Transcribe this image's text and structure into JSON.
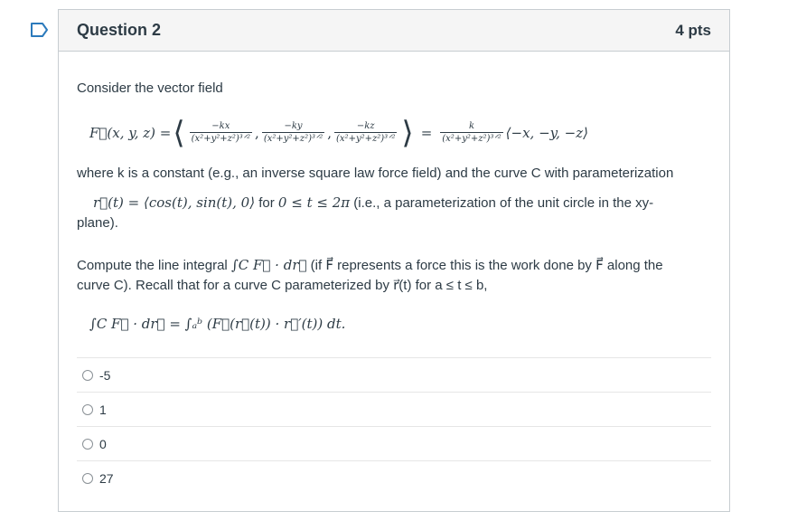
{
  "question": {
    "title": "Question 2",
    "points": "4 pts"
  },
  "body": {
    "intro": "Consider the vector field",
    "eq1_lhs": "F⃗(x, y, z) =",
    "eq1_num1": "−kx",
    "eq1_num2": "−ky",
    "eq1_num3": "−kz",
    "eq1_den": "(x²+y²+z²)³ᐟ²",
    "eq1_eq": "=",
    "eq1_numk": "k",
    "eq1_tail": "⟨−x, −y, −z⟩",
    "where_text": "where k is a constant (e.g., an inverse square law force field) and the curve C with parameterization",
    "param_math": "r⃗(t) = ⟨cos(t), sin(t), 0⟩",
    "param_for": " for ",
    "param_range": "0 ≤ t ≤ 2π",
    "param_rest": " (i.e., a parameterization of the unit circle in the xy-",
    "param_plane": "plane).",
    "compute_1": "Compute the line integral ",
    "compute_int": "∫C F⃗ · dr⃗",
    "compute_2": " (if F⃗ represents a force this is the work done by F⃗ along the",
    "compute_3": "curve C). Recall that for a curve C parameterized by r⃗(t) for a ≤ t ≤ b,",
    "eq3": "∫C F⃗ · dr⃗ = ∫ₐᵇ (F⃗(r⃗(t)) · r⃗′(t)) dt."
  },
  "answers": [
    {
      "label": "-5"
    },
    {
      "label": "1"
    },
    {
      "label": "0"
    },
    {
      "label": "27"
    }
  ],
  "colors": {
    "flag": "#2b7abc",
    "header_bg": "#f5f5f5",
    "border": "#c7cdd1",
    "text": "#2d3b45"
  }
}
